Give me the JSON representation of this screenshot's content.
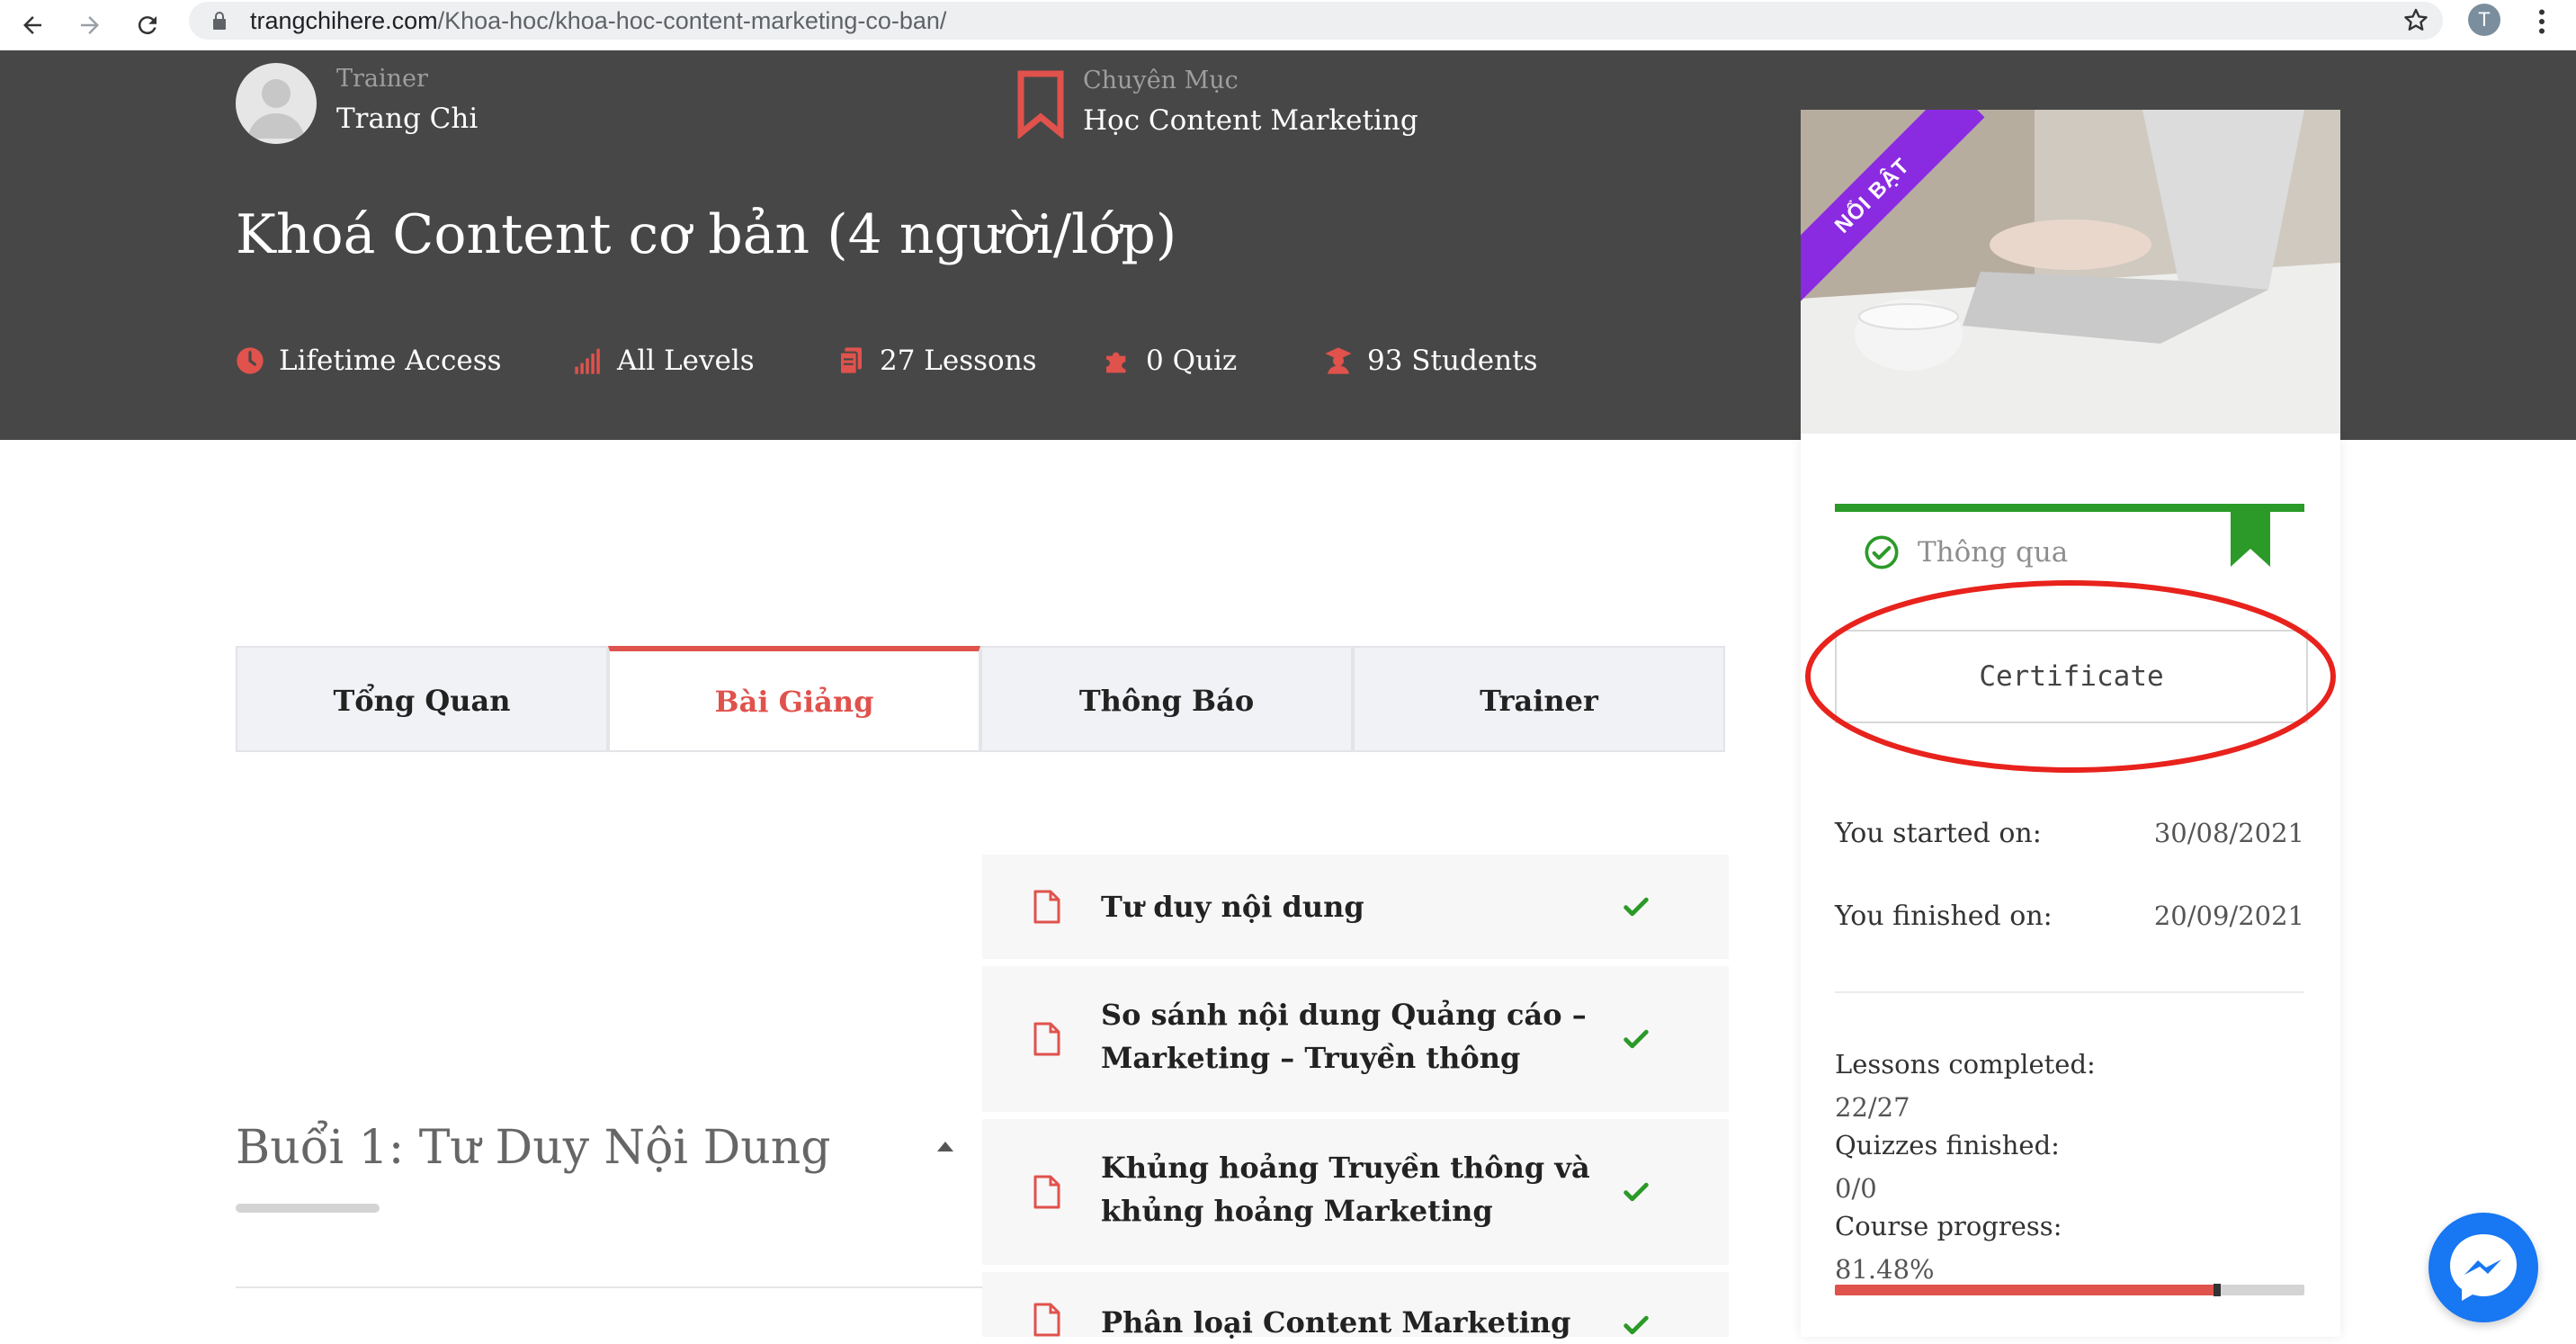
{
  "browser": {
    "url_host": "trangchihere.com",
    "url_path": "/Khoa-hoc/khoa-hoc-content-marketing-co-ban/",
    "profile_initial": "T"
  },
  "hero": {
    "trainer_label": "Trainer",
    "trainer_name": "Trang Chi",
    "category_label": "Chuyên Mục",
    "category_value": "Học Content Marketing",
    "title": "Khoá Content cơ bản (4 người/lớp)",
    "features": [
      {
        "icon": "clock-icon",
        "label": "Lifetime Access"
      },
      {
        "icon": "signal-bars-icon",
        "label": "All Levels"
      },
      {
        "icon": "documents-icon",
        "label": "27 Lessons"
      },
      {
        "icon": "puzzle-icon",
        "label": "0 Quiz"
      },
      {
        "icon": "student-icon",
        "label": "93 Students"
      }
    ]
  },
  "card": {
    "ribbon": "NỔI BẬT",
    "status": "Thông qua",
    "certificate_label": "Certificate",
    "started_label": "You started on:",
    "started_value": "30/08/2021",
    "finished_label": "You finished on:",
    "finished_value": "20/09/2021",
    "lessons_completed_label": "Lessons completed:",
    "lessons_completed_value": "22/27",
    "quizzes_label": "Quizzes finished:",
    "quizzes_value": "0/0",
    "progress_label": "Course progress:",
    "progress_value": "81.48%",
    "progress_fraction": 0.8148
  },
  "tabs": [
    {
      "label": "Tổng Quan",
      "active": false
    },
    {
      "label": "Bài Giảng",
      "active": true
    },
    {
      "label": "Thông Báo",
      "active": false
    },
    {
      "label": "Trainer",
      "active": false
    }
  ],
  "section": {
    "title": "Buổi 1: Tư Duy Nội Dung"
  },
  "lessons": [
    {
      "title": "Tư duy nội dung",
      "done": true
    },
    {
      "title": "So sánh nội dung Quảng cáo – Marketing – Truyền thông",
      "done": true
    },
    {
      "title": "Khủng hoảng Truyền thông và khủng hoảng Marketing",
      "done": true
    },
    {
      "title": "Phân loại Content Marketing",
      "done": true
    }
  ],
  "colors": {
    "accent": "#e0524c",
    "hero_bg": "#474747",
    "success": "#2b9a28",
    "ribbon": "#8a2be2",
    "messenger": "#1877f2"
  }
}
